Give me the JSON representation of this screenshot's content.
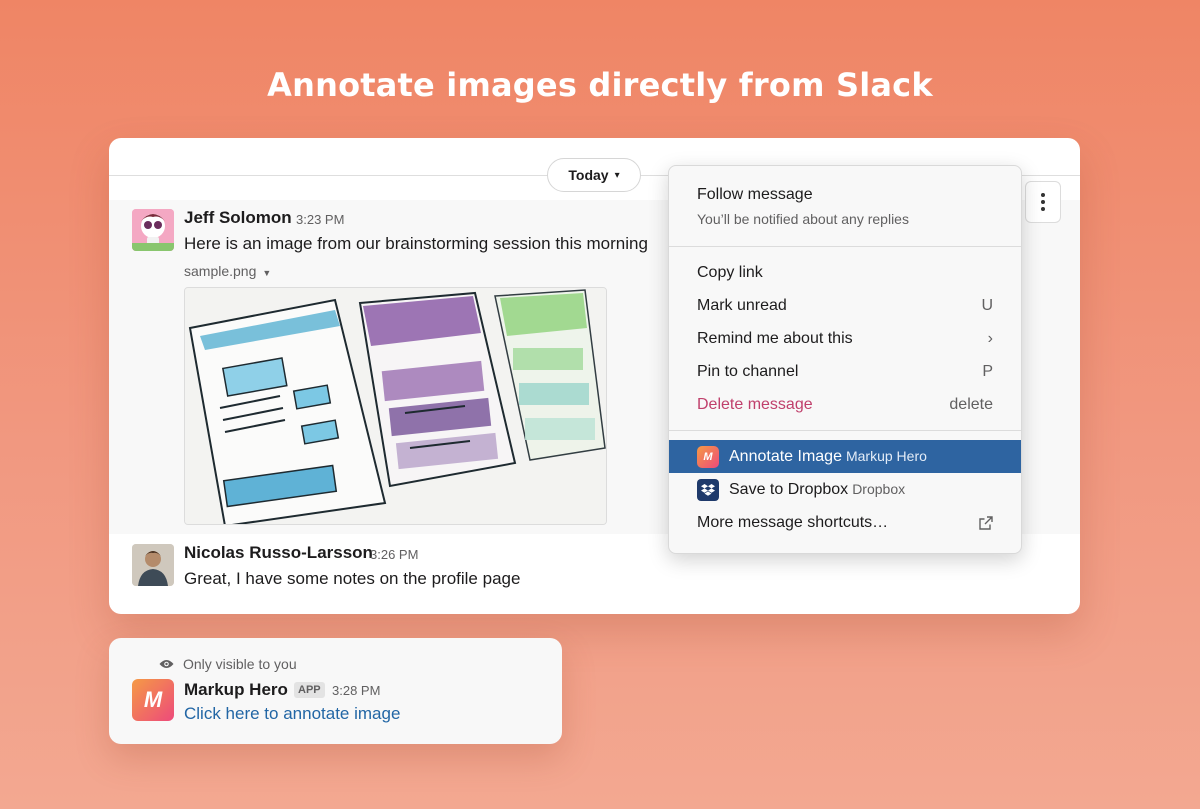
{
  "headline": "Annotate images directly from Slack",
  "divider": {
    "label": "Today"
  },
  "messages": [
    {
      "author": "Jeff Solomon",
      "time": "3:23 PM",
      "text": "Here is an image from our brainstorming session this morning",
      "attachment": {
        "filename": "sample.png"
      }
    },
    {
      "author": "Nicolas Russo-Larsson",
      "time": "3:26 PM",
      "text": "Great, I have some notes on the profile page"
    }
  ],
  "context_menu": {
    "follow": {
      "title": "Follow message",
      "subtitle": "You’ll be notified about any replies"
    },
    "items": [
      {
        "label": "Copy link",
        "hint": ""
      },
      {
        "label": "Mark unread",
        "hint": "U"
      },
      {
        "label": "Remind me about this",
        "hint": "›"
      },
      {
        "label": "Pin to channel",
        "hint": "P"
      },
      {
        "label": "Delete message",
        "hint": "delete"
      }
    ],
    "shortcuts": [
      {
        "label": "Annotate Image",
        "app": "Markup Hero",
        "icon": "markup-hero-icon"
      },
      {
        "label": "Save to Dropbox",
        "app": "Dropbox",
        "icon": "dropbox-icon"
      },
      {
        "label": "More message shortcuts…",
        "icon": "external-link-icon"
      }
    ]
  },
  "ephemeral": {
    "notice": "Only visible to you",
    "author": "Markup Hero",
    "badge": "APP",
    "time": "3:28 PM",
    "link_text": "Click here to annotate image"
  },
  "colors": {
    "background": "#ef8565",
    "menu_active": "#2e64a1",
    "danger": "#c0406c",
    "link": "#2266a5"
  }
}
